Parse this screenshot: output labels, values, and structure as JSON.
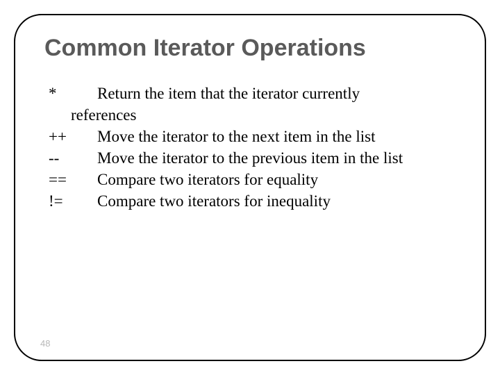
{
  "title": "Common Iterator Operations",
  "ops": [
    {
      "symbol": "*",
      "desc": "Return the item that the iterator currently"
    },
    {
      "symbol": "++",
      "desc": "Move the iterator to the next item in the list"
    },
    {
      "symbol": "--",
      "desc": "Move the iterator to the previous item in the list"
    },
    {
      "symbol": "==",
      "desc": "Compare two iterators for equality"
    },
    {
      "symbol": "!=",
      "desc": "Compare two iterators for inequality"
    }
  ],
  "continuation": "references",
  "page_number": "48"
}
